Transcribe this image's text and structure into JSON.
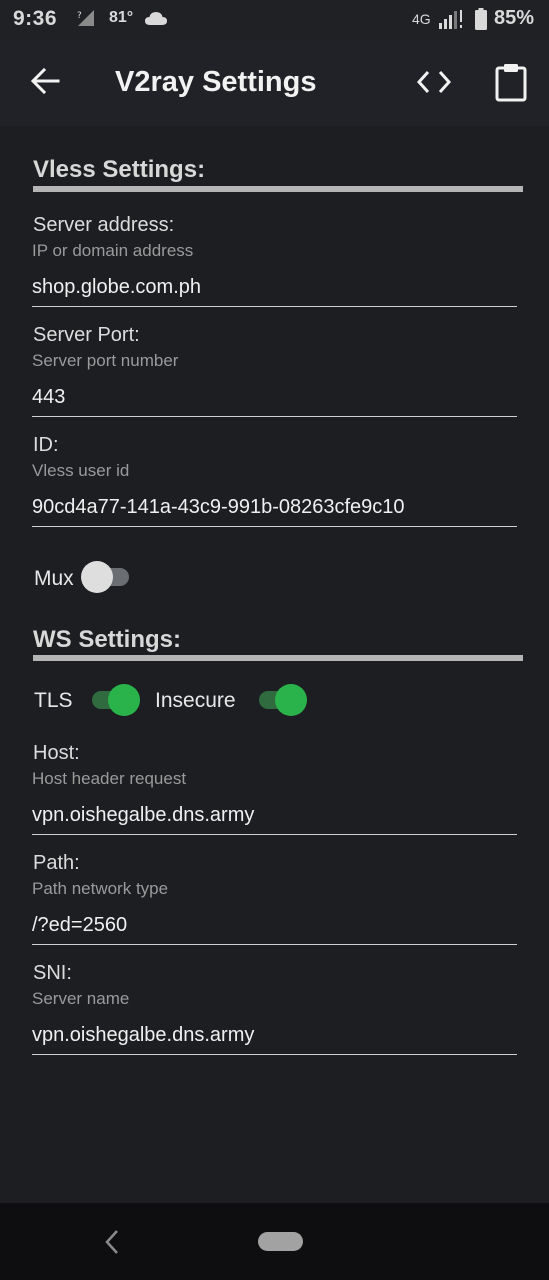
{
  "status_bar": {
    "time": "9:36",
    "temperature": "81°",
    "network": "4G",
    "battery": "85%"
  },
  "app_bar": {
    "title": "V2ray Settings",
    "icons": [
      "back-arrow-icon",
      "code-icon",
      "clipboard-icon"
    ]
  },
  "vless": {
    "section_title": "Vless Settings:",
    "server_address": {
      "label": "Server address:",
      "hint": "IP or domain address",
      "value": "shop.globe.com.ph"
    },
    "server_port": {
      "label": "Server Port:",
      "hint": "Server port number",
      "value": "443"
    },
    "id": {
      "label": "ID:",
      "hint": "Vless user id",
      "value": "90cd4a77-141a-43c9-991b-08263cfe9c10"
    },
    "mux": {
      "label": "Mux",
      "enabled": false
    }
  },
  "ws": {
    "section_title": "WS Settings:",
    "tls": {
      "label": "TLS",
      "enabled": true
    },
    "insecure": {
      "label": "Insecure",
      "enabled": true
    },
    "host": {
      "label": "Host:",
      "hint": "Host header request",
      "value": "vpn.oishegalbe.dns.army"
    },
    "path": {
      "label": "Path:",
      "hint": "Path network type",
      "value": "/?ed=2560"
    },
    "sni": {
      "label": "SNI:",
      "hint": "Server name",
      "value": "vpn.oishegalbe.dns.army"
    }
  },
  "colors": {
    "background": "#1c1e22",
    "switch_on": "#2ab34b",
    "switch_off": "#dedede"
  }
}
